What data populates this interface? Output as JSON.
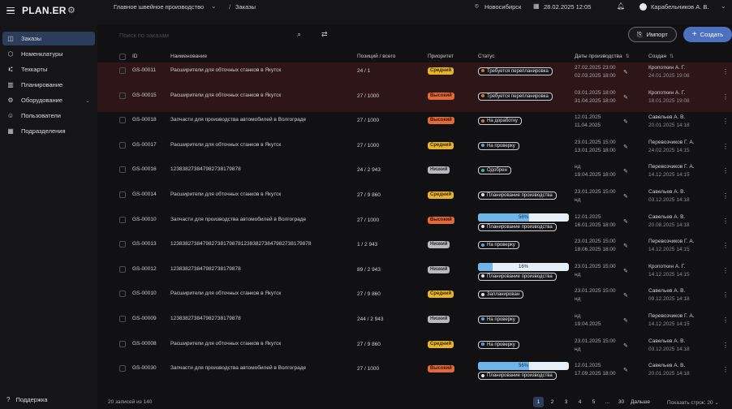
{
  "header": {
    "logo": "PLAN.ER",
    "breadcrumb_root": "Главное швейное производство",
    "breadcrumb_sep": "/",
    "breadcrumb_current": "Заказы",
    "city": "Новосибирск",
    "datetime": "28.02.2025  12:05",
    "user": "Карабельников А. В."
  },
  "sidebar": {
    "items": [
      {
        "label": "Заказы",
        "icon": "orders-icon",
        "glyph": "◫"
      },
      {
        "label": "Номенклатуры",
        "icon": "cube-icon",
        "glyph": "⬡"
      },
      {
        "label": "Техкарты",
        "icon": "flow-icon",
        "glyph": "⑆"
      },
      {
        "label": "Планирование",
        "icon": "chart-icon",
        "glyph": "▥"
      },
      {
        "label": "Оборудование",
        "icon": "gear-icon",
        "glyph": "⚙"
      },
      {
        "label": "Пользователи",
        "icon": "users-icon",
        "glyph": "☺"
      },
      {
        "label": "Подразделения",
        "icon": "building-icon",
        "glyph": "▦"
      }
    ],
    "support": "Поддержка"
  },
  "toolbar": {
    "search_placeholder": "Поиск по заказам",
    "import_label": "Импорт",
    "create_label": "Создать"
  },
  "table": {
    "headers": {
      "id": "ID",
      "name": "Наименование",
      "positions": "Позиций / всего",
      "priority": "Приоритет",
      "status": "Статус",
      "dates": "Даты производства",
      "created": "Создан"
    },
    "rows": [
      {
        "id": "GS-00011",
        "name": "Расширители для обточных станков в Якутск",
        "positions": "24 / 1",
        "priority": "Средний",
        "prio": "mid",
        "status": "Требуется перепланировка",
        "dot": "#e06a3a",
        "progress": null,
        "d1": "27.02.2025  23:00",
        "d2": "02.03.2025  18:00",
        "author": "Кропоткин А. Г.",
        "adate": "24.01.2025  19:08",
        "red": true
      },
      {
        "id": "GS-00015",
        "name": "Расширители для обточных станков в Якутск",
        "positions": "27 / 1000",
        "priority": "Высокий",
        "prio": "high",
        "status": "Требуется перепланировка",
        "dot": "#e06a3a",
        "progress": null,
        "d1": "03.01.2025  18:00",
        "d2": "31.04.2025  18:00",
        "author": "Кропоткин А. Г.",
        "adate": "18.01.2025  19:08",
        "red": true
      },
      {
        "id": "GS-00018",
        "name": "Запчасти для производства автомобилей в Волгограде",
        "positions": "27 / 1000",
        "priority": "Высокий",
        "prio": "high",
        "status": "На доработку",
        "dot": "#e06a3a",
        "progress": null,
        "d1": "12.01.2025",
        "d2": "11.04.2025",
        "author": "Савельев А. В.",
        "adate": "20.01.2025  14:18",
        "red": false
      },
      {
        "id": "GS-00017",
        "name": "Расширители для обточных станков в Якутск",
        "positions": "27 / 1000",
        "priority": "Средний",
        "prio": "mid",
        "status": "На проверку",
        "dot": "#5aa0e0",
        "progress": null,
        "d1": "23.01.2025  15:00",
        "d2": "13.01.2025  18:00",
        "author": "Перевозчиков Г. А.",
        "adate": "24.02.2025  14:15",
        "red": false
      },
      {
        "id": "GS-00016",
        "name": "123838273847982738179878",
        "positions": "24 / 2 943",
        "priority": "Низкий",
        "prio": "low",
        "status": "Одобрен",
        "dot": "#3fb87a",
        "progress": null,
        "d1": "нд",
        "d2": "19.04.2025  18:00",
        "author": "Перевозчиков Г. А.",
        "adate": "14.12.2025  14:15",
        "red": false
      },
      {
        "id": "GS-00014",
        "name": "Расширители для обточных станков в Якутск",
        "positions": "27 / 9 860",
        "priority": "Средний",
        "prio": "mid",
        "status": "Планирование производства",
        "dot": "#e4e4e8",
        "progress": null,
        "d1": "23.01.2025  15:00",
        "d2": "нд",
        "author": "Савельев А. В.",
        "adate": "03.12.2025  14:18",
        "red": false
      },
      {
        "id": "GS-00010",
        "name": "Запчасти для производства автомобилей в Волгограде",
        "positions": "27 / 1000",
        "priority": "Высокий",
        "prio": "high",
        "status": "Планирование производства",
        "dot": "#e4e4e8",
        "progress": 56,
        "d1": "12.01.2025",
        "d2": "16.01.2025  18:00",
        "author": "Савельев А. В.",
        "adate": "20.08.2025  14:18",
        "red": false
      },
      {
        "id": "GS-00013",
        "name": "123838273847982738179878123838273847982738179878",
        "positions": "1 / 2 943",
        "priority": "Низкий",
        "prio": "low",
        "status": "На проверку",
        "dot": "#5aa0e0",
        "progress": null,
        "d1": "23.01.2025  15:00",
        "d2": "18.06.2025  18:00",
        "author": "Перевозчиков Г. А.",
        "adate": "14.12.2025  14:15",
        "red": false
      },
      {
        "id": "GS-00012",
        "name": "123838273847982738179878",
        "positions": "89 / 2 943",
        "priority": "Низкий",
        "prio": "low",
        "status": "Планирование производства",
        "dot": "#e4e4e8",
        "progress": 16,
        "d1": "23.01.2025  15:00",
        "d2": "нд",
        "author": "Кропоткин А. Г.",
        "adate": "14.12.2025  14:15",
        "red": false
      },
      {
        "id": "GS-00010",
        "name": "Расширители для обточных станков в Якутск",
        "positions": "27 / 9 860",
        "priority": "Средний",
        "prio": "mid",
        "status": "Запланирован",
        "dot": "#e4e4e8",
        "progress": null,
        "d1": "23.01.2025  15:00",
        "d2": "нд",
        "author": "Савельев А. В.",
        "adate": "09.12.2025  14:18",
        "red": false
      },
      {
        "id": "GS-00009",
        "name": "123838273847982738179878",
        "positions": "244 / 2 943",
        "priority": "Низкий",
        "prio": "low",
        "status": "На проверку",
        "dot": "#5aa0e0",
        "progress": null,
        "d1": "нд",
        "d2": "19.04.2025",
        "author": "Перевозчиков Г. А.",
        "adate": "14.12.2025  14:15",
        "red": false
      },
      {
        "id": "GS-00008",
        "name": "Расширители для обточных станков в Якутск",
        "positions": "27 / 9 860",
        "priority": "Средний",
        "prio": "mid",
        "status": "На проверку",
        "dot": "#5aa0e0",
        "progress": null,
        "d1": "23.01.2025  15:00",
        "d2": "нд",
        "author": "Савельев А. В.",
        "adate": "03.12.2025  14:18",
        "red": false
      },
      {
        "id": "GS-00030",
        "name": "Запчасти для производства автомобилей в Волгограде",
        "positions": "27 / 1000",
        "priority": "Высокий",
        "prio": "high",
        "status": "Планирование производства",
        "dot": "#e4e4e8",
        "progress": 56,
        "d1": "12.01.2025",
        "d2": "17.09.2025  18:00",
        "author": "Савельев А. В.",
        "adate": "20.01.2025  14:18",
        "red": false
      }
    ]
  },
  "footer": {
    "count": "20 записей из 140",
    "pages": [
      "1",
      "2",
      "3",
      "4",
      "5",
      "...",
      "30",
      "Дальше"
    ],
    "per_page": "Показать строк: 20"
  },
  "colors": {
    "accent": "#4d70c0",
    "active_nav": "#2c3d5c",
    "alert_row": "#2e1618"
  }
}
